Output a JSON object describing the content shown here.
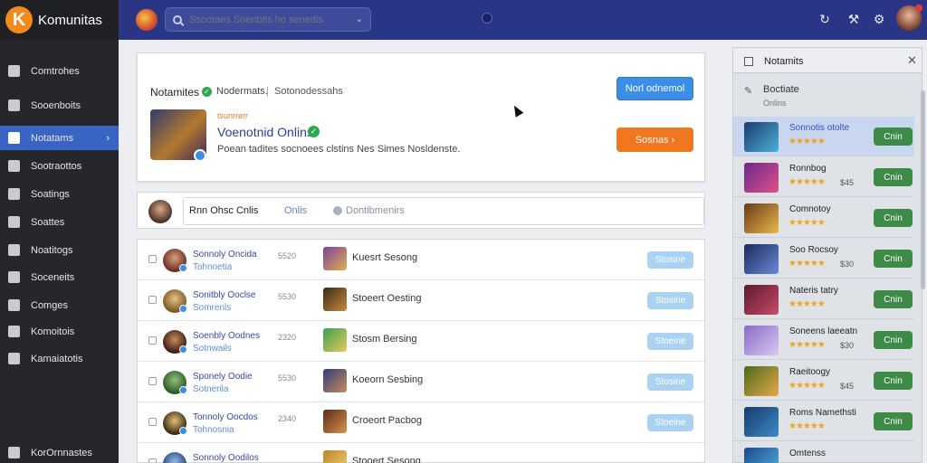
{
  "app": {
    "brand_letter": "K",
    "brand_name": "Komunitas"
  },
  "search": {
    "placeholder": "Ssootaes Soenbtis ho senedis"
  },
  "sidebar": {
    "items": [
      {
        "label": "Comtrohes"
      },
      {
        "label": "Sooenboits"
      },
      {
        "label": "Notatams"
      },
      {
        "label": "Sootraottos"
      },
      {
        "label": "Soatings"
      },
      {
        "label": "Soattes"
      },
      {
        "label": "Noatitogs"
      },
      {
        "label": "Soceneits"
      },
      {
        "label": "Comges"
      },
      {
        "label": "Komoitois"
      },
      {
        "label": "Kamaiatotis"
      },
      {
        "label": "KorOrnnastes"
      }
    ]
  },
  "header_card": {
    "title": "Notamites",
    "sub": "Nodermats.",
    "sep": "|",
    "sub2": "Sotonodessahs",
    "top_button": "Norl odnemol",
    "game_tag": "tsunrrerr",
    "game_name": "Voenotnid Onlins",
    "game_desc": "Poean tadites socnoees clstins Nes Simes Nosldenste.",
    "action_button": "Sosnas ›"
  },
  "filter": {
    "tab_active": "Rnn Ohsc Cnlis",
    "tab_online": "Onlis",
    "tab_docs": "Dontibmenirs"
  },
  "list": [
    {
      "name": "Sonnoly Oncida",
      "sub": "Tohnoetia",
      "num": "5520",
      "game": "Kuesrt Sesong",
      "button": "Stosine"
    },
    {
      "name": "Sonitbly Ooclse",
      "sub": "Somrenls",
      "num": "5530",
      "game": "Stoeert Oesting",
      "button": "Stosine"
    },
    {
      "name": "Soenbly Oodnes",
      "sub": "Sotnwails",
      "num": "2320",
      "game": "Stosm Bersing",
      "button": "Stoeine"
    },
    {
      "name": "Sponely Oodie",
      "sub": "Sotnerila",
      "num": "5530",
      "game": "Koeorn Sesbing",
      "button": "Stosine"
    },
    {
      "name": "Tonnoly Oocdos",
      "sub": "Tohnosnia",
      "num": "2340",
      "game": "Croeort Pacbog",
      "button": "Stoeine"
    },
    {
      "name": "Sonnoly Oodilos",
      "sub": "",
      "num": "",
      "game": "Stooert Sesong",
      "button": ""
    }
  ],
  "right_panel": {
    "title": "Notamits",
    "subtitle": "Boctiate",
    "subline": "Onlins",
    "items": [
      {
        "name": "Sonnotis otolte",
        "stars": "★★★★★",
        "rating": "",
        "button": "Cnin"
      },
      {
        "name": "Ronnbog",
        "stars": "★★★★★",
        "rating": "$45",
        "button": "Cnin"
      },
      {
        "name": "Comnotoy",
        "stars": "★★★★★",
        "rating": "",
        "button": "Cnin"
      },
      {
        "name": "Soo Rocsoy",
        "stars": "★★★★★",
        "rating": "$30",
        "button": "Cnin"
      },
      {
        "name": "Nateris tatry",
        "stars": "★★★★★",
        "rating": "",
        "button": "Cnin"
      },
      {
        "name": "Soneens laeeatn",
        "stars": "★★★★★",
        "rating": "$30",
        "button": "Cnin"
      },
      {
        "name": "Raeitoogy",
        "stars": "★★★★★",
        "rating": "$45",
        "button": "Cnin"
      },
      {
        "name": "Roms Namethsti",
        "stars": "★★★★★",
        "rating": "",
        "button": "Cnin"
      },
      {
        "name": "Omtenss",
        "stars": "★★★★★",
        "rating": "",
        "button": "Cnin"
      }
    ]
  },
  "colors": {
    "topbar": "#2b3585",
    "sidebar": "#25272c",
    "accent_blue": "#3a64c4",
    "brand_orange": "#f28b1c",
    "action_orange": "#f0771f",
    "join_green": "#3d8b46",
    "star_gold": "#f0a418"
  }
}
